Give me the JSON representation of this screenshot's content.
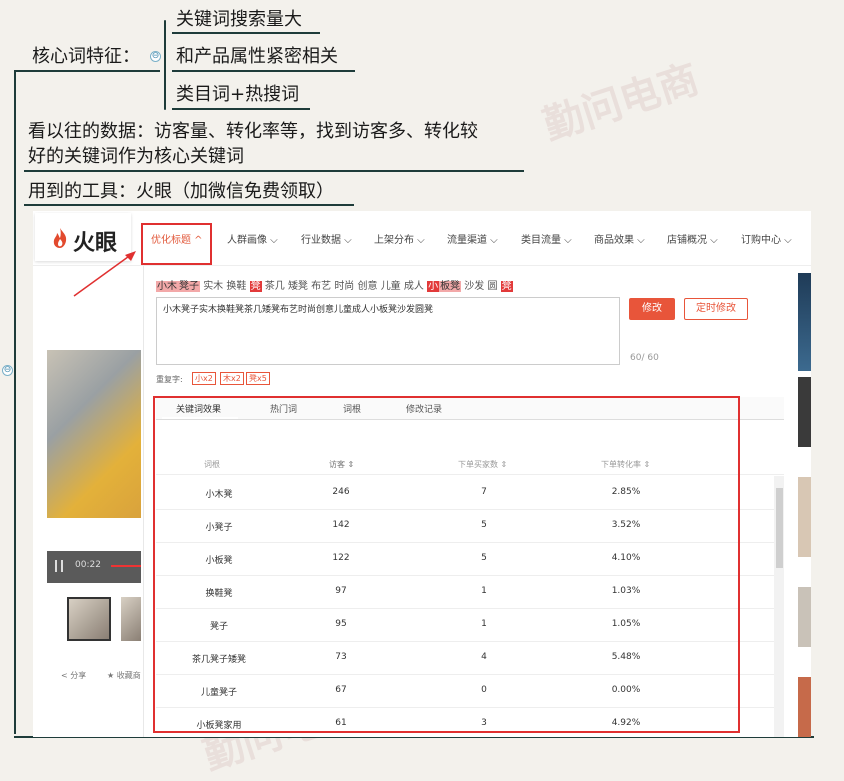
{
  "mindmap": {
    "node1_label": "核心词特征：",
    "node1_children": [
      "关键词搜索量大",
      "和产品属性紧密相关",
      "类目词+热搜词"
    ],
    "node2_text_line1": "看以往的数据：访客量、转化率等，找到访客多、转化较",
    "node2_text_line2": "好的关键词作为核心关键词",
    "node3_text": "用到的工具：火眼（加微信免费领取）",
    "collapse_symbol": "⊖"
  },
  "watermark": "勤问电商",
  "app": {
    "logo": "火眼",
    "nav": [
      "优化标题",
      "人群画像",
      "行业数据",
      "上架分布",
      "流量渠道",
      "类目流量",
      "商品效果",
      "店铺概况",
      "订购中心"
    ],
    "tag_tokens": [
      {
        "text": "小木",
        "style": "hl"
      },
      {
        "text": "凳子",
        "style": "hl"
      },
      {
        "text": "实木",
        "style": ""
      },
      {
        "text": "换鞋",
        "style": ""
      },
      {
        "text": "凳",
        "style": "hl-strong"
      },
      {
        "text": "茶几",
        "style": ""
      },
      {
        "text": "矮凳",
        "style": ""
      },
      {
        "text": "布艺",
        "style": ""
      },
      {
        "text": "时尚",
        "style": ""
      },
      {
        "text": "创意",
        "style": ""
      },
      {
        "text": "儿童",
        "style": ""
      },
      {
        "text": "成人",
        "style": ""
      },
      {
        "text": "小",
        "style": "hl-strong"
      },
      {
        "text": "板凳",
        "style": "hl"
      },
      {
        "text": "沙发",
        "style": ""
      },
      {
        "text": "圆",
        "style": ""
      },
      {
        "text": "凳",
        "style": "hl-strong"
      }
    ],
    "title_value": "小木凳子实木换鞋凳茶几矮凳布艺时尚创意儿童成人小板凳沙发圆凳",
    "char_count": "60/ 60",
    "modify_button": "修改",
    "scheduled_button": "定时修改",
    "dup_label": "重复字:",
    "dup_chips": [
      "小x2",
      "木x2",
      "凳x5"
    ],
    "tabs": [
      "关键词效果",
      "热门词",
      "词根",
      "修改记录"
    ],
    "table": {
      "headers": [
        "词根",
        "访客 ⇕",
        "下单买家数 ⇕",
        "下单转化率 ⇕"
      ],
      "rows": [
        [
          "小木凳",
          "246",
          "7",
          "2.85%"
        ],
        [
          "小凳子",
          "142",
          "5",
          "3.52%"
        ],
        [
          "小板凳",
          "122",
          "5",
          "4.10%"
        ],
        [
          "换鞋凳",
          "97",
          "1",
          "1.03%"
        ],
        [
          "凳子",
          "95",
          "1",
          "1.05%"
        ],
        [
          "茶几凳子矮凳",
          "73",
          "4",
          "5.48%"
        ],
        [
          "儿童凳子",
          "67",
          "0",
          "0.00%"
        ],
        [
          "小板凳家用",
          "61",
          "3",
          "4.92%"
        ]
      ]
    },
    "video_time": "00:22",
    "share_label": "分享",
    "collect_label": "收藏商"
  },
  "colors": {
    "accent": "#e8553a",
    "highlight_box": "#e03030",
    "mindmap_line": "#1e3c3a"
  }
}
